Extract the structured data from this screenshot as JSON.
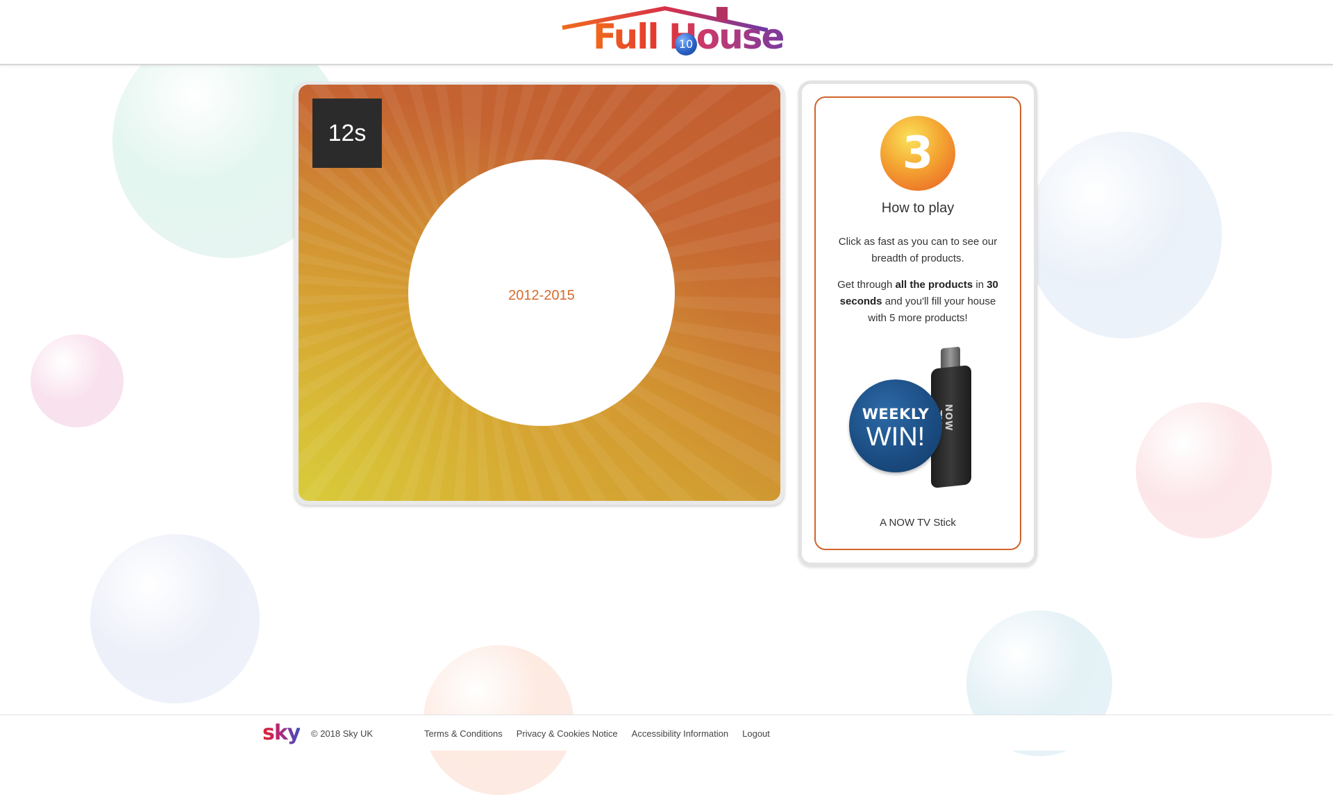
{
  "header": {
    "logo_text": "Full House",
    "logo_ball_number": "10"
  },
  "game": {
    "timer": "12s",
    "target_label": "2012-2015",
    "colors": {
      "gradient_light": "#d9cb3a",
      "gradient_dark": "#c25d30",
      "target_text": "#d66a2c"
    }
  },
  "info": {
    "level_number": "3",
    "title": "How to play",
    "p1": "Click as fast as you can to see our breadth of products.",
    "p2": {
      "a": "Get through ",
      "b": "all the products",
      "c": " in ",
      "d": "30 seconds",
      "e": " and you'll fill your house with 5 more products!"
    },
    "prize_badge_line1": "WEEKLY",
    "prize_badge_line2": "WIN!",
    "stick_brand": "NOW TV",
    "prize_caption": "A NOW TV Stick",
    "accent_color": "#d0632a"
  },
  "footer": {
    "logo": "sky",
    "copyright": "© 2018 Sky UK",
    "links": [
      "Terms & Conditions",
      "Privacy & Cookies Notice",
      "Accessibility Information",
      "Logout"
    ]
  }
}
